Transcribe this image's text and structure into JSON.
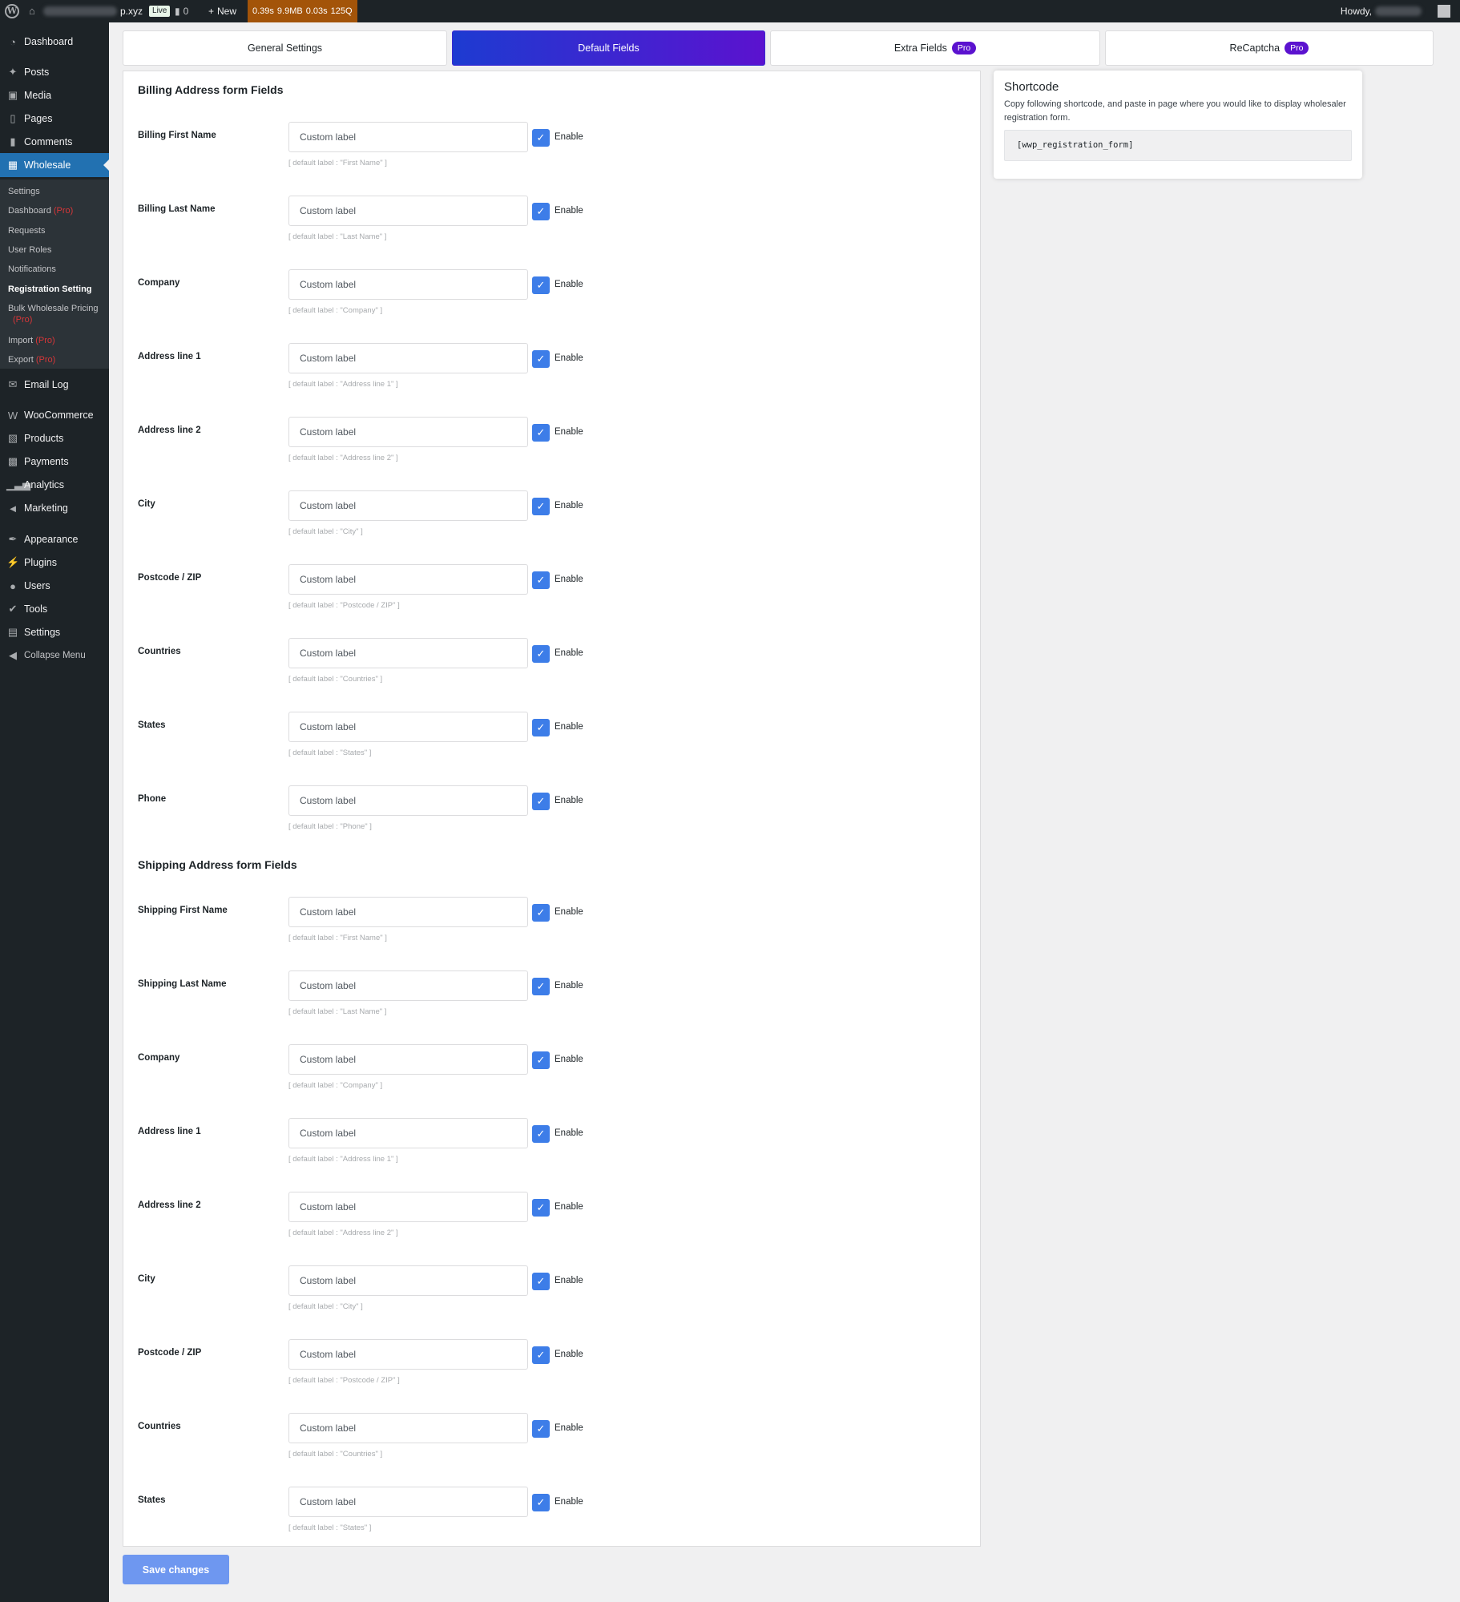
{
  "adminbar": {
    "site_suffix": "p.xyz",
    "live": "Live",
    "comments_count": "0",
    "new_label": "New",
    "qm": [
      "0.39s",
      "9.9MB",
      "0.03s",
      "125Q"
    ],
    "howdy": "Howdy,"
  },
  "sidebar": {
    "top": [
      {
        "label": "Dashboard",
        "icon": "dashboard-icon"
      },
      {
        "label": "Posts",
        "icon": "pin-icon"
      },
      {
        "label": "Media",
        "icon": "media-icon"
      },
      {
        "label": "Pages",
        "icon": "pages-icon"
      },
      {
        "label": "Comments",
        "icon": "comment-icon"
      },
      {
        "label": "Wholesale",
        "icon": "store-icon"
      }
    ],
    "submenu": [
      {
        "label": "Settings",
        "pro": ""
      },
      {
        "label": "Dashboard",
        "pro": "(Pro)"
      },
      {
        "label": "Requests",
        "pro": ""
      },
      {
        "label": "User Roles",
        "pro": ""
      },
      {
        "label": "Notifications",
        "pro": ""
      },
      {
        "label": "Registration Setting",
        "pro": ""
      },
      {
        "label": "Bulk Wholesale Pricing",
        "pro": "(Pro)"
      },
      {
        "label": "Import",
        "pro": "(Pro)"
      },
      {
        "label": "Export",
        "pro": "(Pro)"
      }
    ],
    "bottom": [
      {
        "label": "Email Log",
        "icon": "mail-icon"
      },
      {
        "label": "WooCommerce",
        "icon": "woo-icon"
      },
      {
        "label": "Products",
        "icon": "archive-icon"
      },
      {
        "label": "Payments",
        "icon": "payment-icon"
      },
      {
        "label": "Analytics",
        "icon": "chart-icon"
      },
      {
        "label": "Marketing",
        "icon": "megaphone-icon"
      },
      {
        "label": "Appearance",
        "icon": "brush-icon"
      },
      {
        "label": "Plugins",
        "icon": "plugin-icon"
      },
      {
        "label": "Users",
        "icon": "users-icon"
      },
      {
        "label": "Tools",
        "icon": "wrench-icon"
      },
      {
        "label": "Settings",
        "icon": "settings-icon"
      },
      {
        "label": "Collapse Menu",
        "icon": "collapse-icon"
      }
    ]
  },
  "tabs": [
    {
      "label": "General Settings",
      "badge": ""
    },
    {
      "label": "Default Fields",
      "badge": ""
    },
    {
      "label": "Extra Fields",
      "badge": "Pro"
    },
    {
      "label": "ReCaptcha",
      "badge": "Pro"
    }
  ],
  "billing": {
    "title": "Billing Address form Fields",
    "fields": [
      {
        "label": "Billing First Name",
        "placeholder": "Custom label",
        "enable": "Enable",
        "hint": "[ default label : \"First Name\" ]"
      },
      {
        "label": "Billing Last Name",
        "placeholder": "Custom label",
        "enable": "Enable",
        "hint": "[ default label : \"Last Name\" ]"
      },
      {
        "label": "Company",
        "placeholder": "Custom label",
        "enable": "Enable",
        "hint": "[ default label : \"Company\" ]"
      },
      {
        "label": "Address line 1",
        "placeholder": "Custom label",
        "enable": "Enable",
        "hint": "[ default label : \"Address line 1\" ]"
      },
      {
        "label": "Address line 2",
        "placeholder": "Custom label",
        "enable": "Enable",
        "hint": "[ default label : \"Address line 2\" ]"
      },
      {
        "label": "City",
        "placeholder": "Custom label",
        "enable": "Enable",
        "hint": "[ default label : \"City\" ]"
      },
      {
        "label": "Postcode / ZIP",
        "placeholder": "Custom label",
        "enable": "Enable",
        "hint": "[ default label : \"Postcode / ZIP\" ]"
      },
      {
        "label": "Countries",
        "placeholder": "Custom label",
        "enable": "Enable",
        "hint": "[ default label : \"Countries\" ]"
      },
      {
        "label": "States",
        "placeholder": "Custom label",
        "enable": "Enable",
        "hint": "[ default label : \"States\" ]"
      },
      {
        "label": "Phone",
        "placeholder": "Custom label",
        "enable": "Enable",
        "hint": "[ default label : \"Phone\" ]"
      }
    ]
  },
  "shipping": {
    "title": "Shipping Address form Fields",
    "fields": [
      {
        "label": "Shipping First Name",
        "placeholder": "Custom label",
        "enable": "Enable",
        "hint": "[ default label : \"First Name\" ]"
      },
      {
        "label": "Shipping Last Name",
        "placeholder": "Custom label",
        "enable": "Enable",
        "hint": "[ default label : \"Last Name\" ]"
      },
      {
        "label": "Company",
        "placeholder": "Custom label",
        "enable": "Enable",
        "hint": "[ default label : \"Company\" ]"
      },
      {
        "label": "Address line 1",
        "placeholder": "Custom label",
        "enable": "Enable",
        "hint": "[ default label : \"Address line 1\" ]"
      },
      {
        "label": "Address line 2",
        "placeholder": "Custom label",
        "enable": "Enable",
        "hint": "[ default label : \"Address line 2\" ]"
      },
      {
        "label": "City",
        "placeholder": "Custom label",
        "enable": "Enable",
        "hint": "[ default label : \"City\" ]"
      },
      {
        "label": "Postcode / ZIP",
        "placeholder": "Custom label",
        "enable": "Enable",
        "hint": "[ default label : \"Postcode / ZIP\" ]"
      },
      {
        "label": "Countries",
        "placeholder": "Custom label",
        "enable": "Enable",
        "hint": "[ default label : \"Countries\" ]"
      },
      {
        "label": "States",
        "placeholder": "Custom label",
        "enable": "Enable",
        "hint": "[ default label : \"States\" ]"
      }
    ]
  },
  "shortcode": {
    "title": "Shortcode",
    "description": "Copy following shortcode, and paste in page where you would like to display wholesaler registration form.",
    "code": "[wwp_registration_form]"
  },
  "save_label": "Save changes",
  "colors": {
    "accent": "#2271b1",
    "tab_gradient_start": "#1d3bd1",
    "tab_gradient_end": "#5b12cf",
    "checkbox": "#3d7de8",
    "save": "#6e97f0",
    "pro_red": "#d63638"
  }
}
